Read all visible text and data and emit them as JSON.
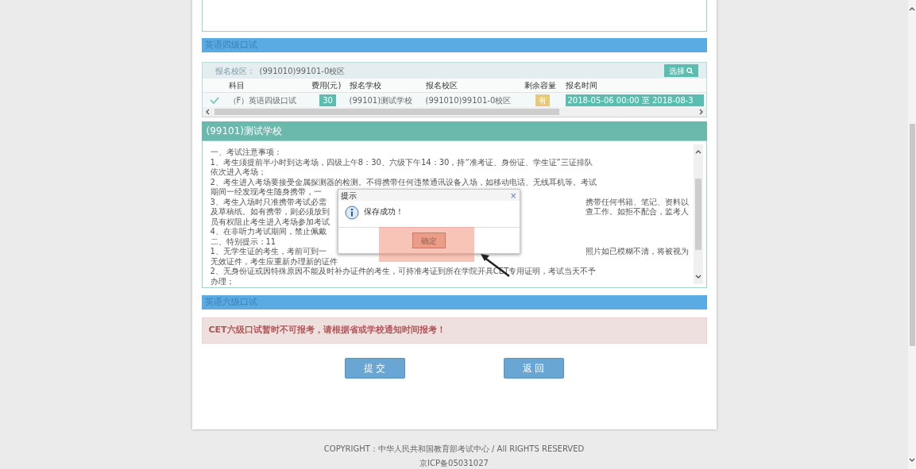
{
  "cet4": {
    "title": "英语四级口试",
    "campus_label": "报名校区：",
    "campus_value": "(991010)99101-0校区",
    "choose_button": "选择",
    "table": {
      "columns": [
        "科目",
        "费用(元)",
        "报名学校",
        "报名校区",
        "剩余容量",
        "报名时间"
      ],
      "rows": [
        {
          "selected": true,
          "subject": "（F）英语四级口试",
          "fee": "30",
          "school": "(99101)测试学校",
          "campus": "(991010)99101-0校区",
          "capacity": "有",
          "time": "2018-05-06 00:00 至 2018-08-3"
        }
      ]
    }
  },
  "school": {
    "title": "(99101)测试学校",
    "notice_lines": [
      {
        "left": "一、考试注意事项："
      },
      {
        "left": "1、考生须提前半小时到达考场，四级上午8：30、六级下午14：30，持“准考证、身份证、学生证”三证排队"
      },
      {
        "left": "依次进入考场；"
      },
      {
        "left": "2、考生进入考场要接受金属探测器的检测。不得携带任何违禁通讯设备入场，如移动电话、无线耳机等。考试"
      },
      {
        "left": "期间一经发现考生随身携带，一"
      },
      {
        "left": "3、考生入场时只准携带考试必需",
        "right": "携带任何书籍、笔记、资料以"
      },
      {
        "left": "及草稿纸。如有携带，则必须放到",
        "right": "查工作。如拒不配合，监考人"
      },
      {
        "left": "员有权阻止考生进入考场参加考试"
      },
      {
        "left": "4、在非听力考试期间，禁止佩戴"
      },
      {
        "left": "二、特别提示：11"
      },
      {
        "left": "1、无学生证的考生，考前可到一",
        "right": "照片如已模糊不清，将被视为"
      },
      {
        "left": "无效证件，考生应重新办理新的证件"
      },
      {
        "left": "2、无身份证或因特殊原因不能及时补办证件的考生，可持准考证到所在学院开具CET专用证明，考试当天不予"
      },
      {
        "left": "办理；"
      }
    ]
  },
  "dialog": {
    "title": "提示",
    "close": "×",
    "message": "保存成功！",
    "ok_button": "确定"
  },
  "cet6": {
    "title": "英语六级口试",
    "alert": "CET六级口试暂时不可报考，请根据省或学校通知时间报考！"
  },
  "buttons": [
    {
      "label": "提 交"
    },
    {
      "label": "返 回"
    }
  ],
  "footer": [
    "COPYRIGHT：中华人民共和国教育部考试中心 / All RIGHTS RESERVED",
    "京ICP备05031027"
  ]
}
